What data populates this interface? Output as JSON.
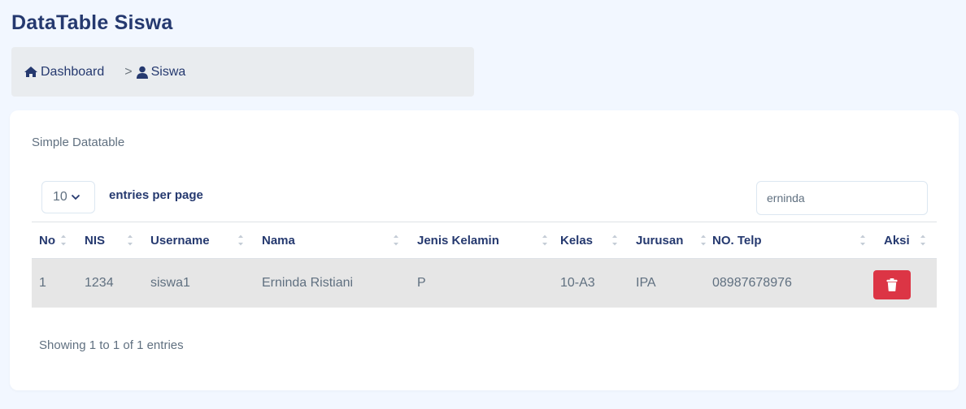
{
  "page": {
    "title": "DataTable Siswa"
  },
  "breadcrumb": {
    "home": "Dashboard",
    "separator": ">",
    "current": "Siswa"
  },
  "card": {
    "title": "Simple Datatable",
    "entries_value": "10",
    "entries_label": "entries per page",
    "search_value": "erninda",
    "info": "Showing 1 to 1 of 1 entries"
  },
  "table": {
    "headers": [
      "No",
      "NIS",
      "Username",
      "Nama",
      "Jenis Kelamin",
      "Kelas",
      "Jurusan",
      "NO. Telp",
      "Aksi"
    ],
    "rows": [
      [
        "1",
        "1234",
        "siswa1",
        "Erninda Ristiani",
        "P",
        "10-A3",
        "IPA",
        "08987678976"
      ]
    ]
  },
  "icons": {
    "home": "home-icon",
    "user": "user-icon",
    "chevron": "chevron-down-icon",
    "sort": "sort-icon",
    "trash": "trash-icon"
  },
  "colors": {
    "primary_text": "#25396f",
    "muted_text": "#607080",
    "delete_button": "#dc3545",
    "row_highlight": "#e6e6e6",
    "background": "#f2f7ff"
  }
}
